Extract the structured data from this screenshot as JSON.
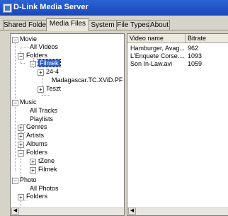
{
  "window": {
    "title": "D-Link Media Server"
  },
  "tabs": [
    "Shared Folder",
    "Media Files",
    "System",
    "File Types",
    "About"
  ],
  "active_tab": "Media Files",
  "tree": {
    "movie": "Movie",
    "all_videos": "All Videos",
    "folders": "Folders",
    "filmek": "Filmek",
    "item_24_4": "24-4",
    "madagascar": "Madagascar.TC.XViD.PF",
    "teszt": "Teszt",
    "music": "Music",
    "all_tracks": "All Tracks",
    "playlists": "Playlists",
    "genres": "Genres",
    "artists": "Artists",
    "albums": "Albums",
    "music_folders": "Folders",
    "tzene": "tZene",
    "filmek2": "Filmek",
    "photo": "Photo",
    "all_photos": "All Photos",
    "photo_folders": "Folders"
  },
  "list": {
    "columns": [
      "Video name",
      "Bitrate"
    ],
    "rows": [
      {
        "name": "Hamburger, Avag...",
        "bitrate": "962"
      },
      {
        "name": "L'Enquete Corse....",
        "bitrate": "1093"
      },
      {
        "name": "Son In-Law.avi",
        "bitrate": "1059"
      }
    ]
  },
  "icons": [
    "app-icon",
    "expand-icon",
    "collapse-icon",
    "scroll-left-icon"
  ]
}
